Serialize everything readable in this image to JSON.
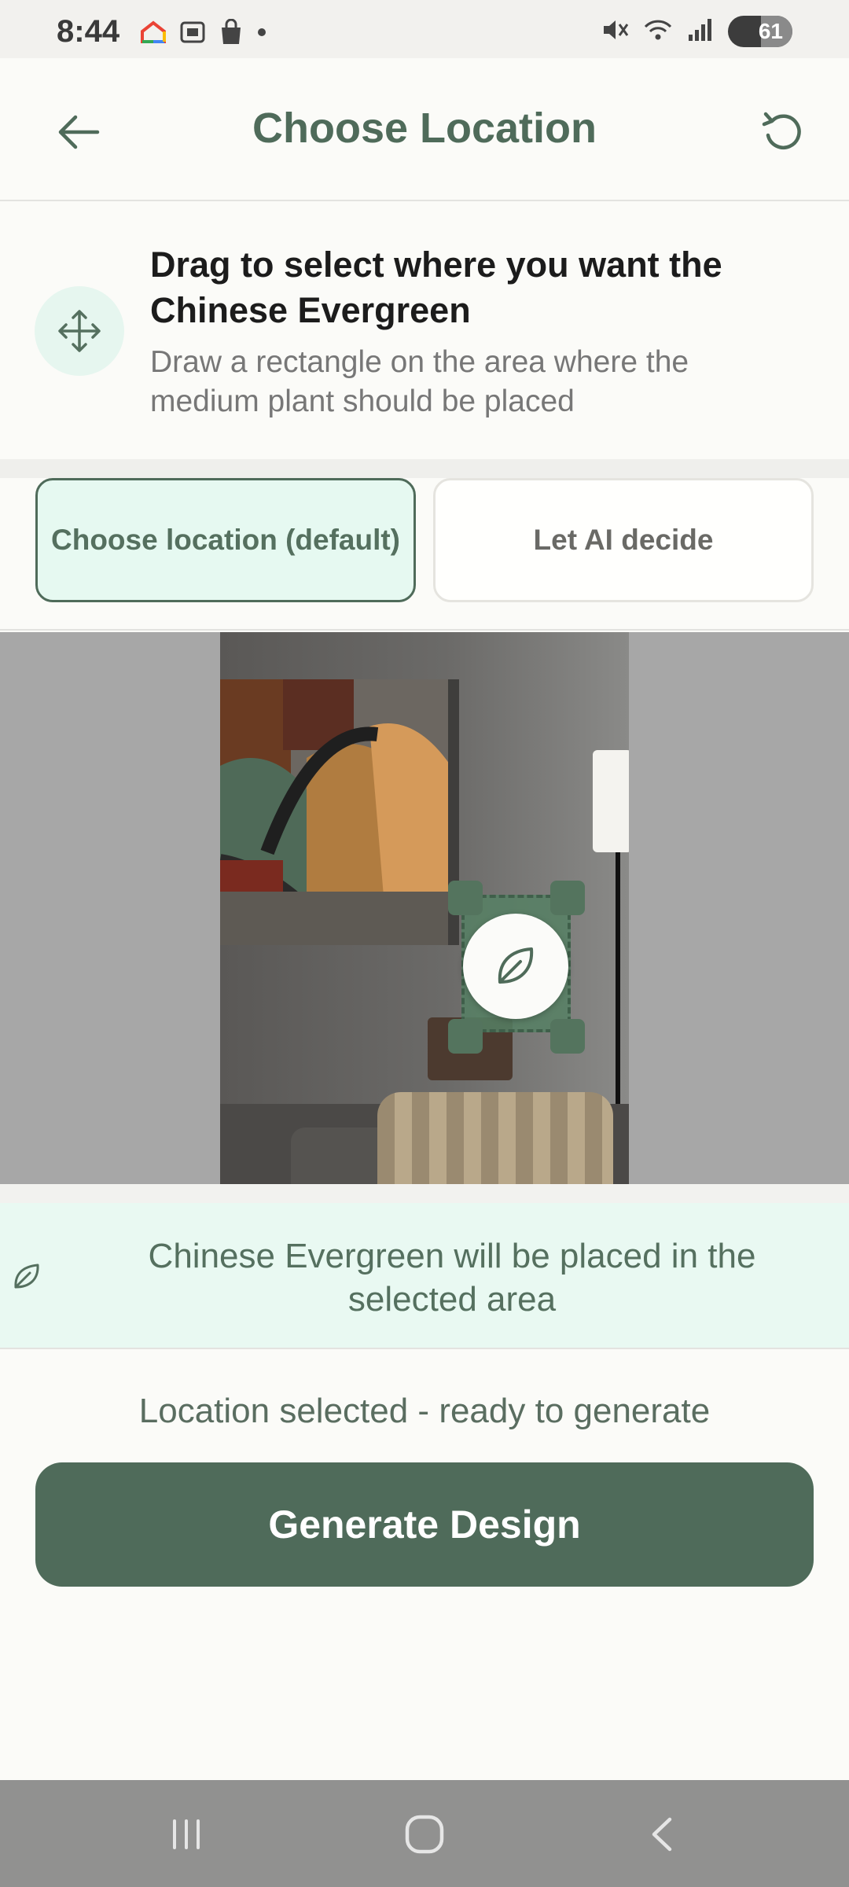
{
  "status_bar": {
    "time": "8:44",
    "battery": "61",
    "icons_left": [
      "google-home-icon",
      "screenshot-icon",
      "shopping-bag-icon",
      "dot-icon"
    ],
    "icons_right": [
      "mute-icon",
      "wifi-icon",
      "signal-icon",
      "battery-icon"
    ]
  },
  "header": {
    "title": "Choose Location",
    "back_icon": "arrow-left-icon",
    "refresh_icon": "refresh-icon"
  },
  "instruction": {
    "icon": "move-icon",
    "title": "Drag to select where you want the Chinese Evergreen",
    "subtitle": "Draw a rectangle on the area where the medium plant should be placed"
  },
  "mode_toggle": {
    "options": [
      {
        "label": "Choose location (default)",
        "selected": true
      },
      {
        "label": "Let AI decide",
        "selected": false
      }
    ]
  },
  "canvas": {
    "selection_icon": "leaf-icon"
  },
  "info_banner": {
    "icon": "leaf-icon",
    "text": "Chinese Evergreen will be placed in the selected area"
  },
  "status_text": "Location selected - ready to generate",
  "generate_button": {
    "label": "Generate Design"
  },
  "colors": {
    "primary": "#4f6b5a",
    "accent_bg": "#e6f9f1",
    "title_color": "#4f6b5a"
  },
  "nav_bar": {
    "buttons": [
      "recents-icon",
      "home-icon",
      "back-icon"
    ]
  }
}
